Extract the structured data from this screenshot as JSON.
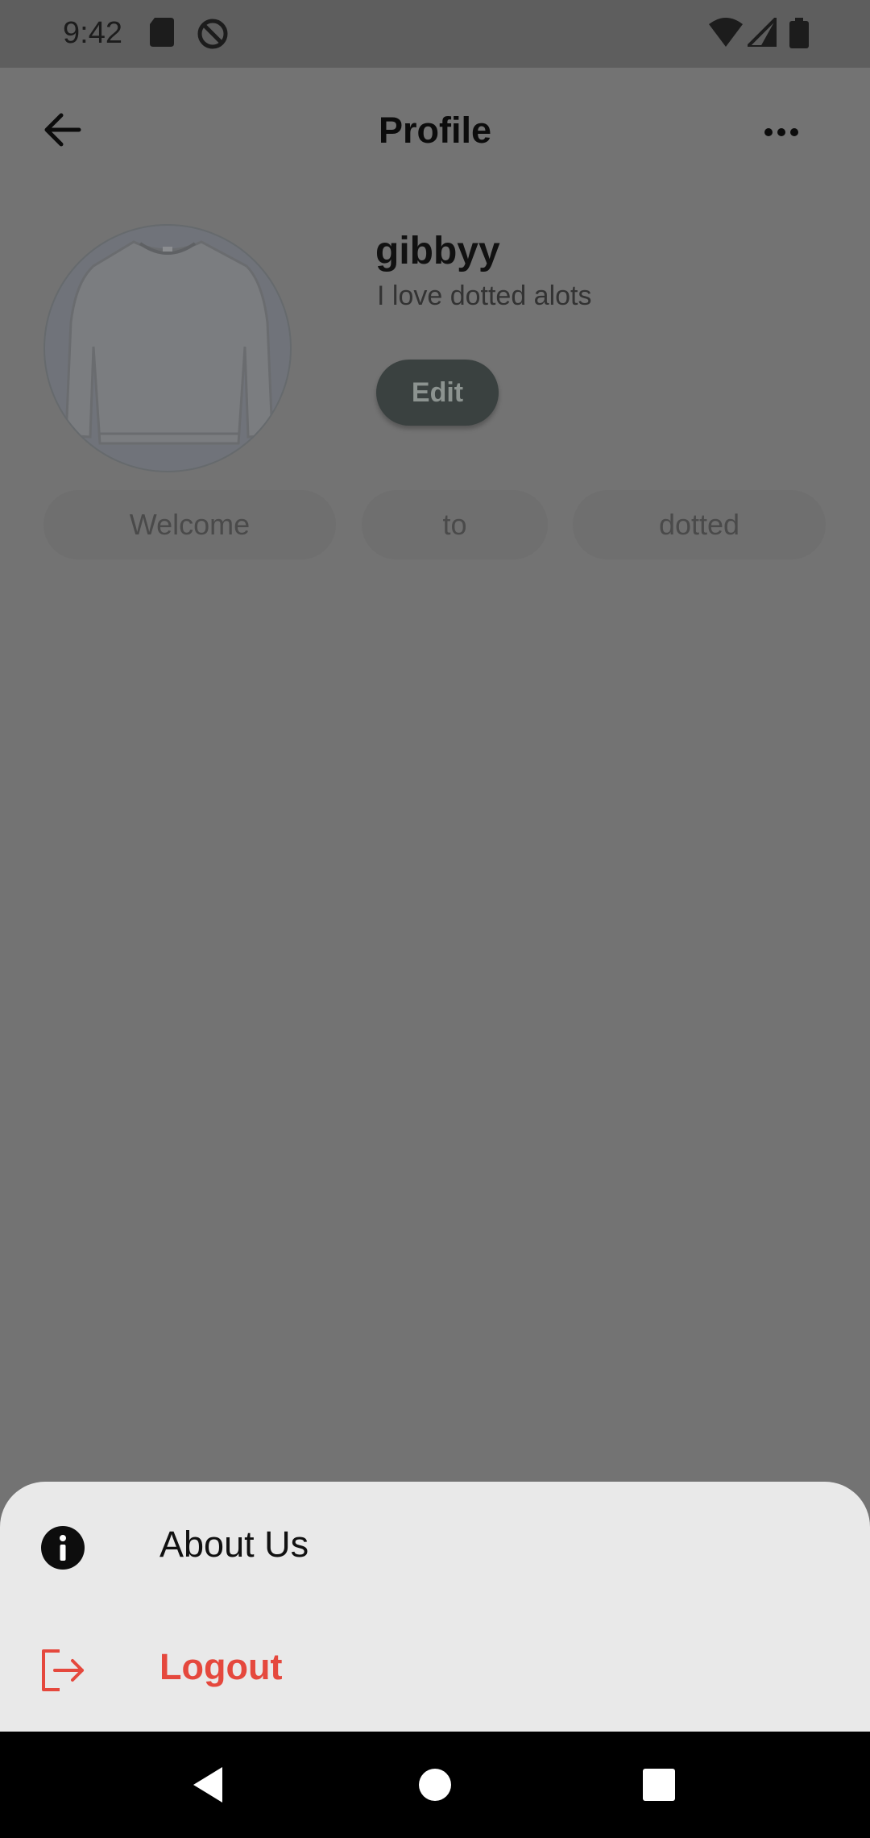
{
  "status_bar": {
    "time": "9:42",
    "icons": [
      "sd-card-icon",
      "no-disturb-icon",
      "wifi-icon",
      "signal-icon",
      "battery-icon"
    ]
  },
  "appbar": {
    "title": "Profile",
    "back_icon": "arrow-left-icon",
    "more_icon": "more-horizontal-icon"
  },
  "profile": {
    "username": "gibbyy",
    "bio": "I love dotted alots",
    "edit_label": "Edit",
    "avatar_icon": "sweater-avatar"
  },
  "chips": [
    "Welcome",
    "to",
    "dotted"
  ],
  "bottom_sheet": {
    "items": [
      {
        "label": "About Us",
        "icon": "info-icon"
      },
      {
        "label": "Logout",
        "icon": "logout-icon"
      }
    ],
    "logout_color": "#e5483d"
  },
  "nav_bar": {
    "icons": [
      "back-triangle-icon",
      "home-circle-icon",
      "recents-square-icon"
    ]
  }
}
